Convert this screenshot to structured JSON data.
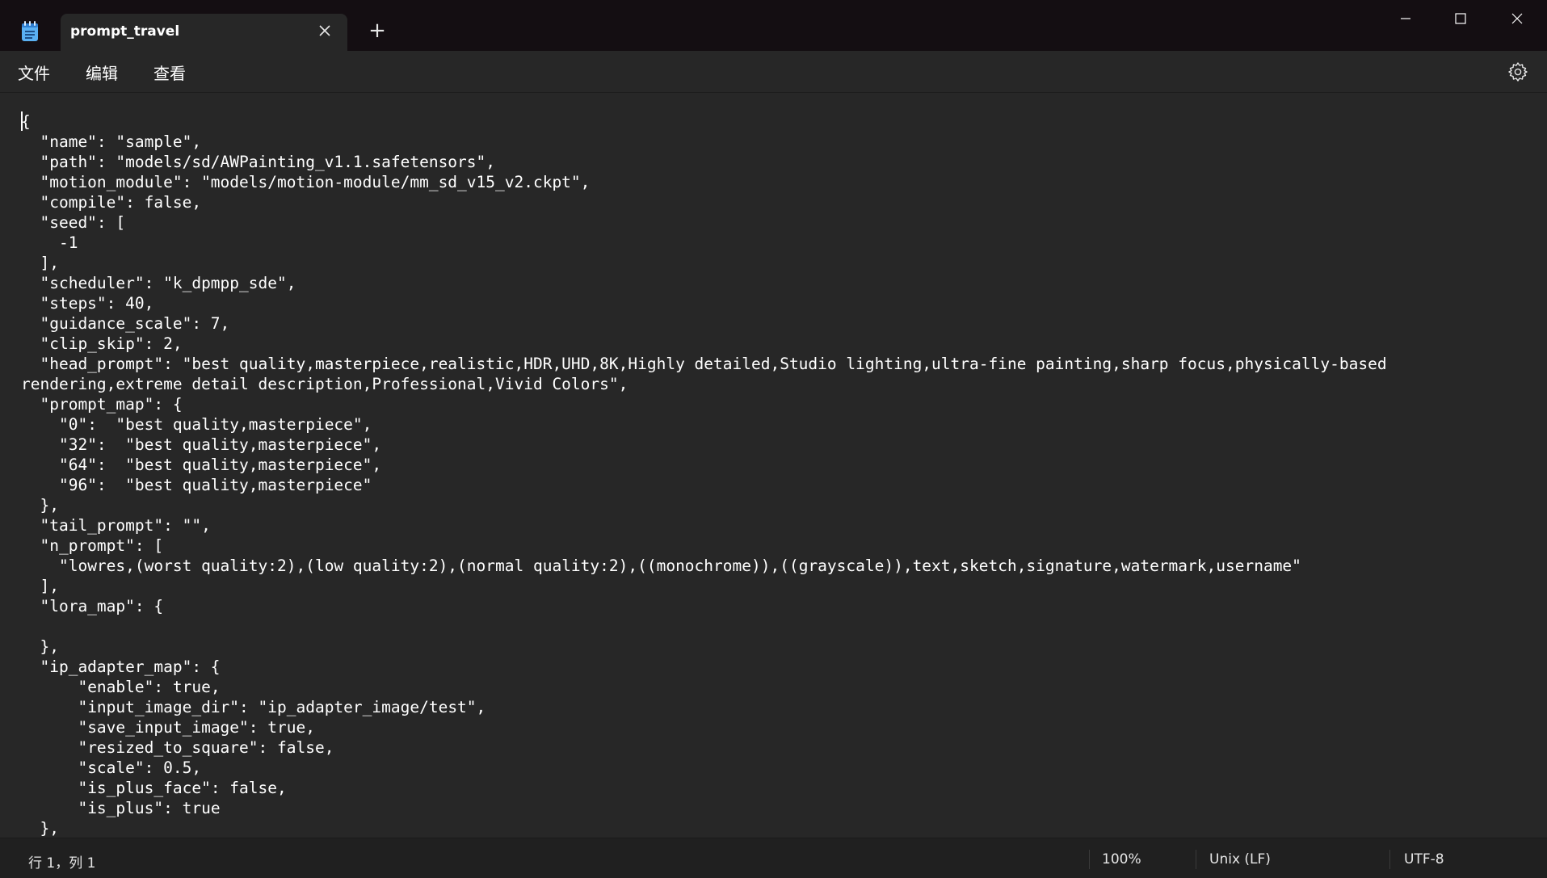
{
  "window": {
    "tab_title": "prompt_travel",
    "tab_close_icon": "close-icon",
    "new_tab_label": "+",
    "app_icon": "notepad-icon",
    "controls": [
      "minimize-icon",
      "maximize-icon",
      "close-icon"
    ]
  },
  "menu": {
    "file": "文件",
    "edit": "编辑",
    "view": "查看",
    "settings_icon": "gear-icon"
  },
  "editor": {
    "content": "{\n  \"name\": \"sample\",\n  \"path\": \"models/sd/AWPainting_v1.1.safetensors\",\n  \"motion_module\": \"models/motion-module/mm_sd_v15_v2.ckpt\",\n  \"compile\": false,\n  \"seed\": [\n    -1\n  ],\n  \"scheduler\": \"k_dpmpp_sde\",\n  \"steps\": 40,\n  \"guidance_scale\": 7,\n  \"clip_skip\": 2,\n  \"head_prompt\": \"best quality,masterpiece,realistic,HDR,UHD,8K,Highly detailed,Studio lighting,ultra-fine painting,sharp focus,physically-based rendering,extreme detail description,Professional,Vivid Colors\",\n  \"prompt_map\": {\n    \"0\":  \"best quality,masterpiece\",\n    \"32\":  \"best quality,masterpiece\",\n    \"64\":  \"best quality,masterpiece\",\n    \"96\":  \"best quality,masterpiece\"\n  },\n  \"tail_prompt\": \"\",\n  \"n_prompt\": [\n    \"lowres,(worst quality:2),(low quality:2),(normal quality:2),((monochrome)),((grayscale)),text,sketch,signature,watermark,username\"\n  ],\n  \"lora_map\": {\n\n  },\n  \"ip_adapter_map\": {\n      \"enable\": true,\n      \"input_image_dir\": \"ip_adapter_image/test\",\n      \"save_input_image\": true,\n      \"resized_to_square\": false,\n      \"scale\": 0.5,\n      \"is_plus_face\": false,\n      \"is_plus\": true\n  },"
  },
  "status": {
    "position": "行 1，列 1",
    "zoom": "100%",
    "line_ending": "Unix (LF)",
    "encoding": "UTF-8"
  }
}
